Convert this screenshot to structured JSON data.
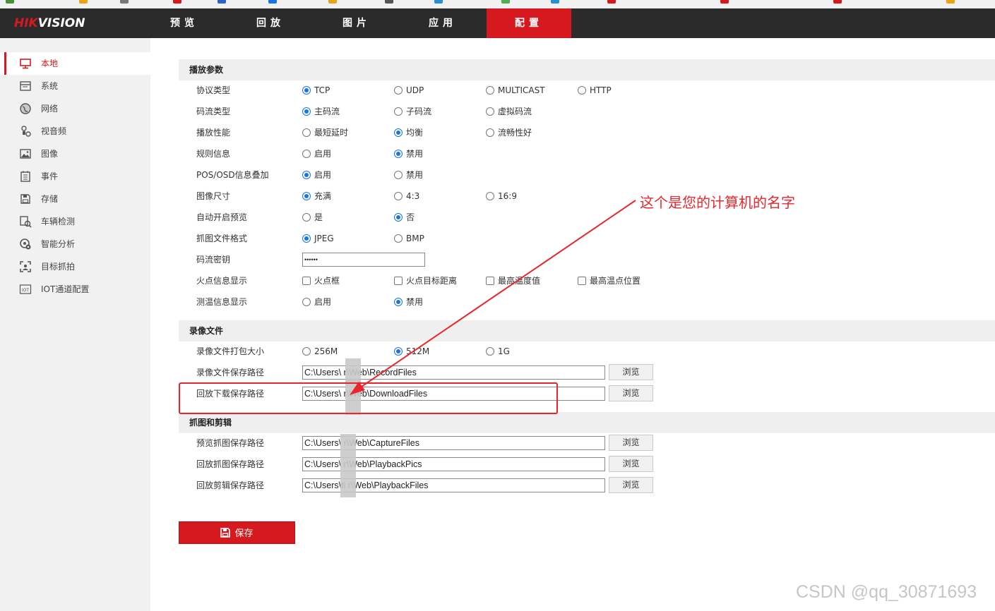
{
  "brand": {
    "logo_red": "HIK",
    "logo_white": "VISION",
    "accent": "#d6191e"
  },
  "nav": {
    "tabs": [
      {
        "label": "预览"
      },
      {
        "label": "回放"
      },
      {
        "label": "图片"
      },
      {
        "label": "应用"
      },
      {
        "label": "配置"
      }
    ],
    "active": "配置"
  },
  "sidebar": {
    "items": [
      {
        "label": "本地",
        "icon": "monitor-icon",
        "active": true
      },
      {
        "label": "系统",
        "icon": "system-icon"
      },
      {
        "label": "网络",
        "icon": "globe-icon"
      },
      {
        "label": "视音频",
        "icon": "audio-video-icon"
      },
      {
        "label": "图像",
        "icon": "image-icon"
      },
      {
        "label": "事件",
        "icon": "event-icon"
      },
      {
        "label": "存储",
        "icon": "storage-icon"
      },
      {
        "label": "车辆检测",
        "icon": "vehicle-detect-icon"
      },
      {
        "label": "智能分析",
        "icon": "smart-analysis-icon"
      },
      {
        "label": "目标抓拍",
        "icon": "target-capture-icon"
      },
      {
        "label": "IOT通道配置",
        "icon": "iot-icon"
      }
    ]
  },
  "sections": {
    "playback": {
      "title": "播放参数",
      "rows": [
        {
          "label": "协议类型",
          "type": "radio",
          "options": [
            "TCP",
            "UDP",
            "MULTICAST",
            "HTTP"
          ],
          "selected": 0
        },
        {
          "label": "码流类型",
          "type": "radio",
          "options": [
            "主码流",
            "子码流",
            "虚拟码流"
          ],
          "selected": 0
        },
        {
          "label": "播放性能",
          "type": "radio",
          "options": [
            "最短延时",
            "均衡",
            "流畅性好"
          ],
          "selected": 1
        },
        {
          "label": "规则信息",
          "type": "radio",
          "options": [
            "启用",
            "禁用"
          ],
          "selected": 1
        },
        {
          "label": "POS/OSD信息叠加",
          "type": "radio",
          "options": [
            "启用",
            "禁用"
          ],
          "selected": 0
        },
        {
          "label": "图像尺寸",
          "type": "radio",
          "options": [
            "充满",
            "4:3",
            "16:9"
          ],
          "selected": 0
        },
        {
          "label": "自动开启预览",
          "type": "radio",
          "options": [
            "是",
            "否"
          ],
          "selected": 1
        },
        {
          "label": "抓图文件格式",
          "type": "radio",
          "options": [
            "JPEG",
            "BMP"
          ],
          "selected": 0
        },
        {
          "label": "码流密钥",
          "type": "password",
          "value": "••••••"
        },
        {
          "label": "火点信息显示",
          "type": "checkbox",
          "options": [
            "火点框",
            "火点目标距离",
            "最高温度值",
            "最高温点位置"
          ]
        },
        {
          "label": "测温信息显示",
          "type": "radio",
          "options": [
            "启用",
            "禁用"
          ],
          "selected": 1
        }
      ]
    },
    "record": {
      "title": "录像文件",
      "rows": [
        {
          "label": "录像文件打包大小",
          "type": "radio",
          "options": [
            "256M",
            "512M",
            "1G"
          ],
          "selected": 1
        },
        {
          "label": "录像文件保存路径",
          "type": "path",
          "value": "C:\\Users\\      r\\Web\\RecordFiles",
          "button": "浏览"
        },
        {
          "label": "回放下载保存路径",
          "type": "path",
          "value": "C:\\Users\\      r\\Web\\DownloadFiles",
          "button": "浏览"
        }
      ]
    },
    "capture": {
      "title": "抓图和剪辑",
      "rows": [
        {
          "label": "预览抓图保存路径",
          "type": "path",
          "value": "C:\\Users\\      r\\Web\\CaptureFiles",
          "button": "浏览"
        },
        {
          "label": "回放抓图保存路径",
          "type": "path",
          "value": "C:\\Users\\      r\\Web\\PlaybackPics",
          "button": "浏览"
        },
        {
          "label": "回放剪辑保存路径",
          "type": "path",
          "value": "C:\\Users\\ti      r\\Web\\PlaybackFiles",
          "button": "浏览"
        }
      ]
    }
  },
  "save_button": {
    "label": "保存",
    "icon": "floppy-icon"
  },
  "annotation": {
    "text": "这个是您的计算机的名字",
    "color": "#e8262b"
  },
  "watermark": "CSDN @qq_30871693"
}
